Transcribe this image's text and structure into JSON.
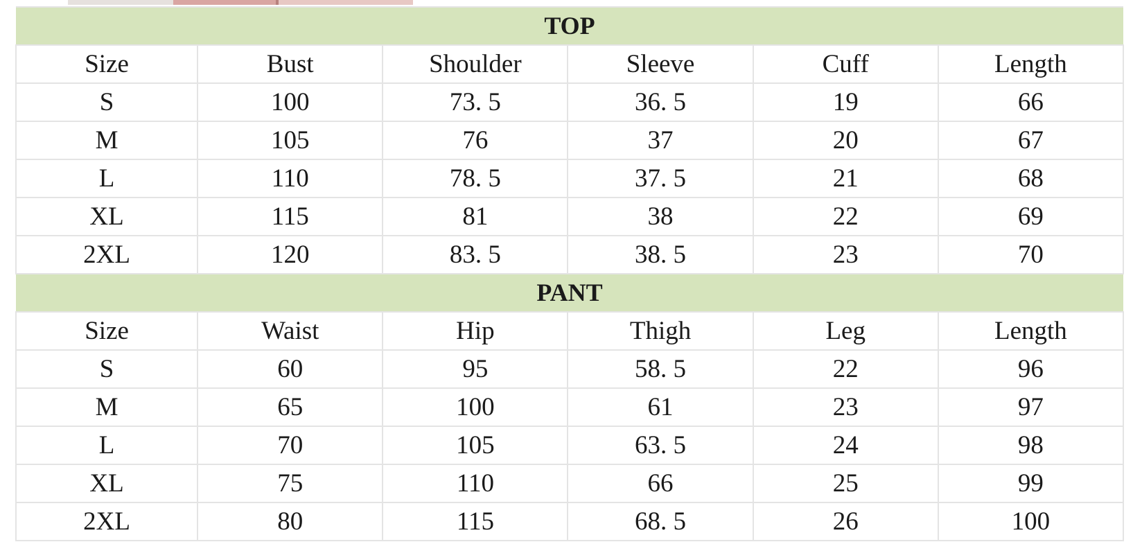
{
  "top": {
    "title": "TOP",
    "headers": [
      "Size",
      "Bust",
      "Shoulder",
      "Sleeve",
      "Cuff",
      "Length"
    ],
    "rows": [
      [
        "S",
        "100",
        "73. 5",
        "36. 5",
        "19",
        "66"
      ],
      [
        "M",
        "105",
        "76",
        "37",
        "20",
        "67"
      ],
      [
        "L",
        "110",
        "78. 5",
        "37. 5",
        "21",
        "68"
      ],
      [
        "XL",
        "115",
        "81",
        "38",
        "22",
        "69"
      ],
      [
        "2XL",
        "120",
        "83. 5",
        "38. 5",
        "23",
        "70"
      ]
    ]
  },
  "pant": {
    "title": "PANT",
    "headers": [
      "Size",
      "Waist",
      "Hip",
      "Thigh",
      "Leg",
      "Length"
    ],
    "rows": [
      [
        "S",
        "60",
        "95",
        "58. 5",
        "22",
        "96"
      ],
      [
        "M",
        "65",
        "100",
        "61",
        "23",
        "97"
      ],
      [
        "L",
        "70",
        "105",
        "63. 5",
        "24",
        "98"
      ],
      [
        "XL",
        "75",
        "110",
        "66",
        "25",
        "99"
      ],
      [
        "2XL",
        "80",
        "115",
        "68. 5",
        "26",
        "100"
      ]
    ]
  }
}
